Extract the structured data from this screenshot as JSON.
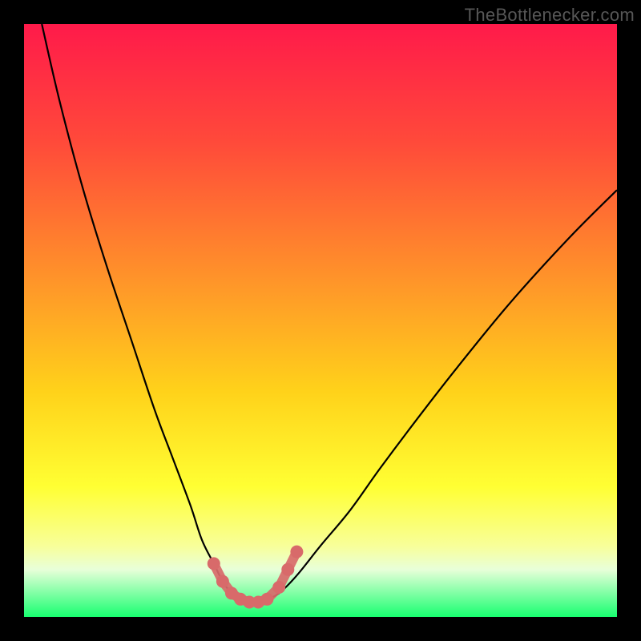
{
  "watermark": "TheBottlenecker.com",
  "colors": {
    "bg": "#000000",
    "curve": "#000000",
    "marker": "#d86a6a",
    "gradient_stops": [
      {
        "offset": 0.0,
        "color": "#ff1a4a"
      },
      {
        "offset": 0.2,
        "color": "#ff4a3a"
      },
      {
        "offset": 0.45,
        "color": "#ff9a28"
      },
      {
        "offset": 0.62,
        "color": "#ffd21a"
      },
      {
        "offset": 0.78,
        "color": "#ffff33"
      },
      {
        "offset": 0.88,
        "color": "#f8ff99"
      },
      {
        "offset": 0.92,
        "color": "#e8ffd9"
      },
      {
        "offset": 1.0,
        "color": "#18ff70"
      }
    ]
  },
  "chart_data": {
    "type": "line",
    "title": "",
    "xlabel": "",
    "ylabel": "",
    "xlim": [
      0,
      100
    ],
    "ylim": [
      0,
      100
    ],
    "series": [
      {
        "name": "bottleneck-curve",
        "x": [
          3,
          6,
          10,
          14,
          18,
          22,
          25,
          28,
          30,
          32,
          33.5,
          35,
          36.5,
          38,
          39.5,
          41,
          43,
          46,
          50,
          55,
          60,
          66,
          73,
          82,
          92,
          100
        ],
        "y": [
          100,
          87,
          72,
          59,
          47,
          35,
          27,
          19,
          13,
          9,
          6,
          4,
          3,
          2.5,
          2.5,
          3,
          4,
          7,
          12,
          18,
          25,
          33,
          42,
          53,
          64,
          72
        ]
      }
    ],
    "markers": {
      "name": "highlighted-points",
      "x": [
        32,
        33.5,
        35,
        36.5,
        38,
        39.5,
        41,
        43,
        44.5,
        46
      ],
      "y": [
        9,
        6,
        4,
        3,
        2.5,
        2.5,
        3,
        5,
        8,
        11
      ]
    }
  }
}
